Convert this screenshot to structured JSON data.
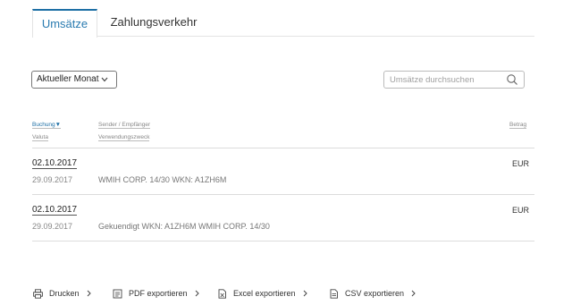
{
  "tabs": [
    {
      "label": "Umsätze",
      "active": true
    },
    {
      "label": "Zahlungsverkehr",
      "active": false
    }
  ],
  "filter": {
    "month_label": "Aktueller Monat"
  },
  "search": {
    "placeholder": "Umsätze durchsuchen"
  },
  "columns": {
    "booking": "Buchung▼",
    "valuta": "Valuta",
    "sender": "Sender / Empfänger",
    "purpose": "Verwendungszweck",
    "amount": "Betrag"
  },
  "transactions": [
    {
      "booking_date": "02.10.2017",
      "valuta_date": "29.09.2017",
      "purpose": "WMIH CORP. 14/30 WKN: A1ZH6M",
      "currency": "EUR"
    },
    {
      "booking_date": "02.10.2017",
      "valuta_date": "29.09.2017",
      "purpose": "Gekuendigt WKN: A1ZH6M WMIH CORP. 14/30",
      "currency": "EUR"
    }
  ],
  "actions": [
    {
      "label": "Drucken",
      "icon": "printer-icon"
    },
    {
      "label": "PDF exportieren",
      "icon": "pdf-icon"
    },
    {
      "label": "Excel exportieren",
      "icon": "excel-icon"
    },
    {
      "label": "CSV exportieren",
      "icon": "csv-icon"
    }
  ],
  "colors": {
    "accent": "#1d6fa5"
  }
}
